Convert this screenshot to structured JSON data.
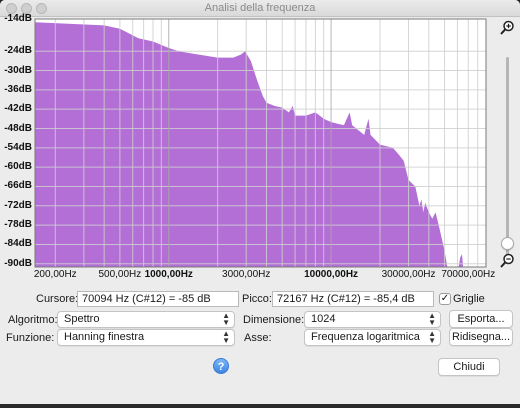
{
  "window": {
    "title": "Analisi della frequenza"
  },
  "chart_data": {
    "type": "area",
    "title": "",
    "xlabel": "",
    "ylabel": "",
    "x_scale": "log",
    "xlim": [
      150,
      90000
    ],
    "ylim": [
      -91,
      -14
    ],
    "grid": true,
    "fill_color": "#b36fd6",
    "y_tick_labels": [
      "-14dB",
      "-24dB",
      "-30dB",
      "-36dB",
      "-42dB",
      "-48dB",
      "-54dB",
      "-60dB",
      "-66dB",
      "-72dB",
      "-78dB",
      "-84dB",
      "-90dB"
    ],
    "y_tick_values": [
      -14,
      -24,
      -30,
      -36,
      -42,
      -48,
      -54,
      -60,
      -66,
      -72,
      -78,
      -84,
      -90
    ],
    "x_tick_labels": [
      "200,00Hz",
      "500,00Hz",
      "1000,00Hz",
      "3000,00Hz",
      "10000,00Hz",
      "30000,00Hz",
      "70000,00Hz"
    ],
    "x_tick_values": [
      200,
      500,
      1000,
      3000,
      10000,
      30000,
      70000
    ],
    "x_tick_bold": [
      false,
      false,
      true,
      false,
      true,
      false,
      false
    ],
    "points": [
      [
        150,
        -15
      ],
      [
        400,
        -16
      ],
      [
        500,
        -17
      ],
      [
        650,
        -20
      ],
      [
        800,
        -21
      ],
      [
        1000,
        -23
      ],
      [
        1150,
        -24
      ],
      [
        1500,
        -25
      ],
      [
        2000,
        -26
      ],
      [
        2500,
        -26
      ],
      [
        2800,
        -25
      ],
      [
        2950,
        -24
      ],
      [
        3200,
        -27
      ],
      [
        3500,
        -33
      ],
      [
        3800,
        -38
      ],
      [
        4000,
        -40
      ],
      [
        4500,
        -41
      ],
      [
        5000,
        -41.5
      ],
      [
        5500,
        -43
      ],
      [
        5800,
        -41
      ],
      [
        6000,
        -44
      ],
      [
        7000,
        -44
      ],
      [
        8000,
        -43
      ],
      [
        9000,
        -45
      ],
      [
        10000,
        -46
      ],
      [
        12000,
        -47
      ],
      [
        13000,
        -43
      ],
      [
        13500,
        -47
      ],
      [
        16000,
        -50
      ],
      [
        17000,
        -45
      ],
      [
        17500,
        -50
      ],
      [
        20000,
        -53
      ],
      [
        24000,
        -54
      ],
      [
        26000,
        -56
      ],
      [
        28000,
        -58
      ],
      [
        30000,
        -64
      ],
      [
        33000,
        -66
      ],
      [
        35000,
        -72
      ],
      [
        36000,
        -70
      ],
      [
        37000,
        -74
      ],
      [
        38000,
        -71
      ],
      [
        40000,
        -74
      ],
      [
        42000,
        -76
      ],
      [
        44000,
        -74
      ],
      [
        46000,
        -78
      ],
      [
        50000,
        -86
      ],
      [
        52000,
        -91
      ],
      [
        61000,
        -91
      ],
      [
        62500,
        -88
      ],
      [
        64000,
        -87
      ],
      [
        65000,
        -91
      ],
      [
        90000,
        -91
      ]
    ]
  },
  "controls": {
    "cursor_label": "Cursore:",
    "cursor_value": "70094 Hz (C#12) = -85 dB",
    "peak_label": "Picco:",
    "peak_value": "72167 Hz (C#12) = -85,4 dB",
    "grid_label": "Griglie",
    "grid_checked": "✓",
    "algorithm_label": "Algoritmo:",
    "algorithm_value": "Spettro",
    "size_label": "Dimensione:",
    "size_value": "1024",
    "export_button": "Esporta...",
    "function_label": "Funzione:",
    "function_value": "Hanning finestra",
    "axis_label": "Asse:",
    "axis_value": "Frequenza logaritmica",
    "replot_button": "Ridisegna...",
    "help_glyph": "?",
    "close_button": "Chiudi"
  }
}
